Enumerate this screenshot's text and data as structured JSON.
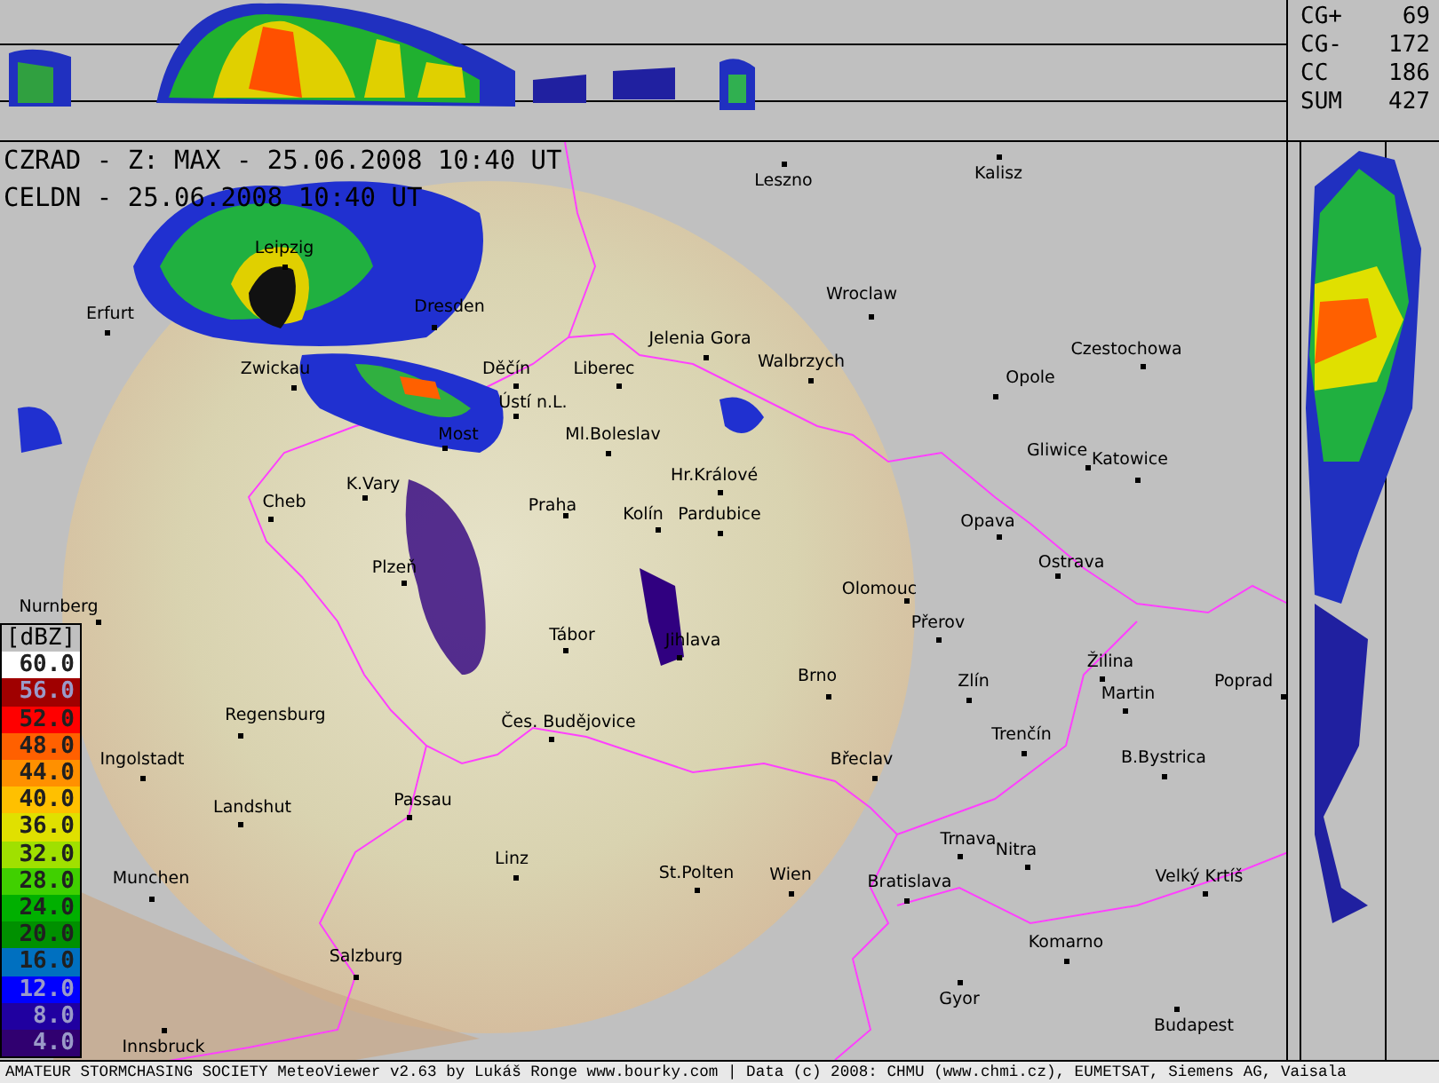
{
  "header": {
    "lines": [
      "CZRAD - Z: MAX - 25.06.2008 10:40 UT",
      "CELDN - 25.06.2008 10:40 UT"
    ]
  },
  "lightning_stats": [
    {
      "label": "CG+",
      "value": "69"
    },
    {
      "label": "CG-",
      "value": "172"
    },
    {
      "label": "CC",
      "value": "186"
    },
    {
      "label": "SUM",
      "value": "427"
    }
  ],
  "legend": {
    "title": "[dBZ]",
    "items": [
      {
        "label": "60.0",
        "color": "#ffffff"
      },
      {
        "label": "56.0",
        "color": "#a00000"
      },
      {
        "label": "52.0",
        "color": "#ff0000"
      },
      {
        "label": "48.0",
        "color": "#ff6000"
      },
      {
        "label": "44.0",
        "color": "#ff9000"
      },
      {
        "label": "40.0",
        "color": "#ffc000"
      },
      {
        "label": "36.0",
        "color": "#e0e000"
      },
      {
        "label": "32.0",
        "color": "#a0e000"
      },
      {
        "label": "28.0",
        "color": "#40d000"
      },
      {
        "label": "24.0",
        "color": "#00b000"
      },
      {
        "label": "20.0",
        "color": "#009000"
      },
      {
        "label": "16.0",
        "color": "#0070c0"
      },
      {
        "label": "12.0",
        "color": "#0000ff"
      },
      {
        "label": "8.0",
        "color": "#2000a0"
      },
      {
        "label": "4.0",
        "color": "#300070"
      }
    ]
  },
  "cities": [
    {
      "name": "Leszno"
    },
    {
      "name": "Kalisz"
    },
    {
      "name": "Erfurt"
    },
    {
      "name": "Leipzig"
    },
    {
      "name": "Dresden"
    },
    {
      "name": "Wroclaw"
    },
    {
      "name": "Jelenia Gora"
    },
    {
      "name": "Walbrzych"
    },
    {
      "name": "Czestochowa"
    },
    {
      "name": "Zwickau"
    },
    {
      "name": "Děčín"
    },
    {
      "name": "Liberec"
    },
    {
      "name": "Opole"
    },
    {
      "name": "Ústí n.L."
    },
    {
      "name": "Most"
    },
    {
      "name": "Ml.Boleslav"
    },
    {
      "name": "Gliwice"
    },
    {
      "name": "Katowice"
    },
    {
      "name": "Hr.Králové"
    },
    {
      "name": "K.Vary"
    },
    {
      "name": "Cheb"
    },
    {
      "name": "Praha"
    },
    {
      "name": "Kolín"
    },
    {
      "name": "Pardubice"
    },
    {
      "name": "Opava"
    },
    {
      "name": "Ostrava"
    },
    {
      "name": "Plzeň"
    },
    {
      "name": "Olomouc"
    },
    {
      "name": "Nurnberg"
    },
    {
      "name": "Přerov"
    },
    {
      "name": "Tábor"
    },
    {
      "name": "Jihlava"
    },
    {
      "name": "Žilina"
    },
    {
      "name": "Brno"
    },
    {
      "name": "Zlín"
    },
    {
      "name": "Martin"
    },
    {
      "name": "Poprad"
    },
    {
      "name": "Regensburg"
    },
    {
      "name": "Čes. Budějovice"
    },
    {
      "name": "Trenčín"
    },
    {
      "name": "Ingolstadt"
    },
    {
      "name": "Břeclav"
    },
    {
      "name": "B.Bystrica"
    },
    {
      "name": "Landshut"
    },
    {
      "name": "Passau"
    },
    {
      "name": "Trnava"
    },
    {
      "name": "Nitra"
    },
    {
      "name": "Munchen"
    },
    {
      "name": "Linz"
    },
    {
      "name": "St.Polten"
    },
    {
      "name": "Wien"
    },
    {
      "name": "Bratislava"
    },
    {
      "name": "Velký Krtíš"
    },
    {
      "name": "Komarno"
    },
    {
      "name": "Salzburg"
    },
    {
      "name": "Gyor"
    },
    {
      "name": "Budapest"
    },
    {
      "name": "Innsbruck"
    }
  ],
  "footer": "AMATEUR STORMCHASING SOCIETY MeteoViewer v2.63 by Lukáš Ronge www.bourky.com | Data (c) 2008: CHMU (www.chmi.cz), EUMETSAT, Siemens AG, Vaisala"
}
